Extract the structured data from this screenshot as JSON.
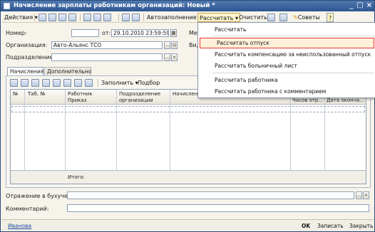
{
  "window": {
    "title": "Начисление зарплаты работникам организаций: Новый *",
    "controls": [
      "_",
      "□",
      "×"
    ]
  },
  "toolbar": {
    "actions": "Действия",
    "autofill": "Автозаполнение",
    "calculate": "Рассчитать",
    "clear": "Очистить",
    "tips": "Советы",
    "help": "?"
  },
  "form": {
    "number_label": "Номер:",
    "number_value": "",
    "date_prefix": "от:",
    "date_value": "29.10.2010 23:59:59",
    "month_label": "Мес",
    "org_label": "Организация:",
    "org_value": "Авто-Альянс ТСО",
    "type_label": "Вид",
    "dept_label": "Подразделение:",
    "dept_value": ""
  },
  "tabs": [
    "Начисления",
    "Дополнительно"
  ],
  "grid_toolbar": {
    "fill": "Заполнить",
    "select": "Подбор"
  },
  "grid": {
    "columns": {
      "num": "№",
      "tab_num": "Таб. №",
      "worker": "Работник",
      "order": "Приказ",
      "dept": "Подразделение",
      "dept2": "организации",
      "accrual": "Начисление",
      "hours": "Часов отр...",
      "end_date": "Дата оконча..."
    },
    "footer_total": "Итого:"
  },
  "dropdown": {
    "items": [
      "Рассчитать",
      "Рассчитать отпуск",
      "Рассчитать компенсацию за неиспользованный отпуск",
      "Рассчитать больничный лист",
      "Рассчитать работника",
      "Рассчитать работника с комментарием"
    ]
  },
  "bottom": {
    "reflection_label": "Отражение в бухучете:",
    "reflection_value": "",
    "comment_label": "Комментарий:",
    "comment_value": ""
  },
  "status": {
    "user": "Иванова",
    "ok": "OK",
    "save": "Записать",
    "close": "Закрыть"
  },
  "colors": {
    "title_bg": "#2d5590",
    "selected_border": "#e33333",
    "link": "#1f4fa0"
  }
}
